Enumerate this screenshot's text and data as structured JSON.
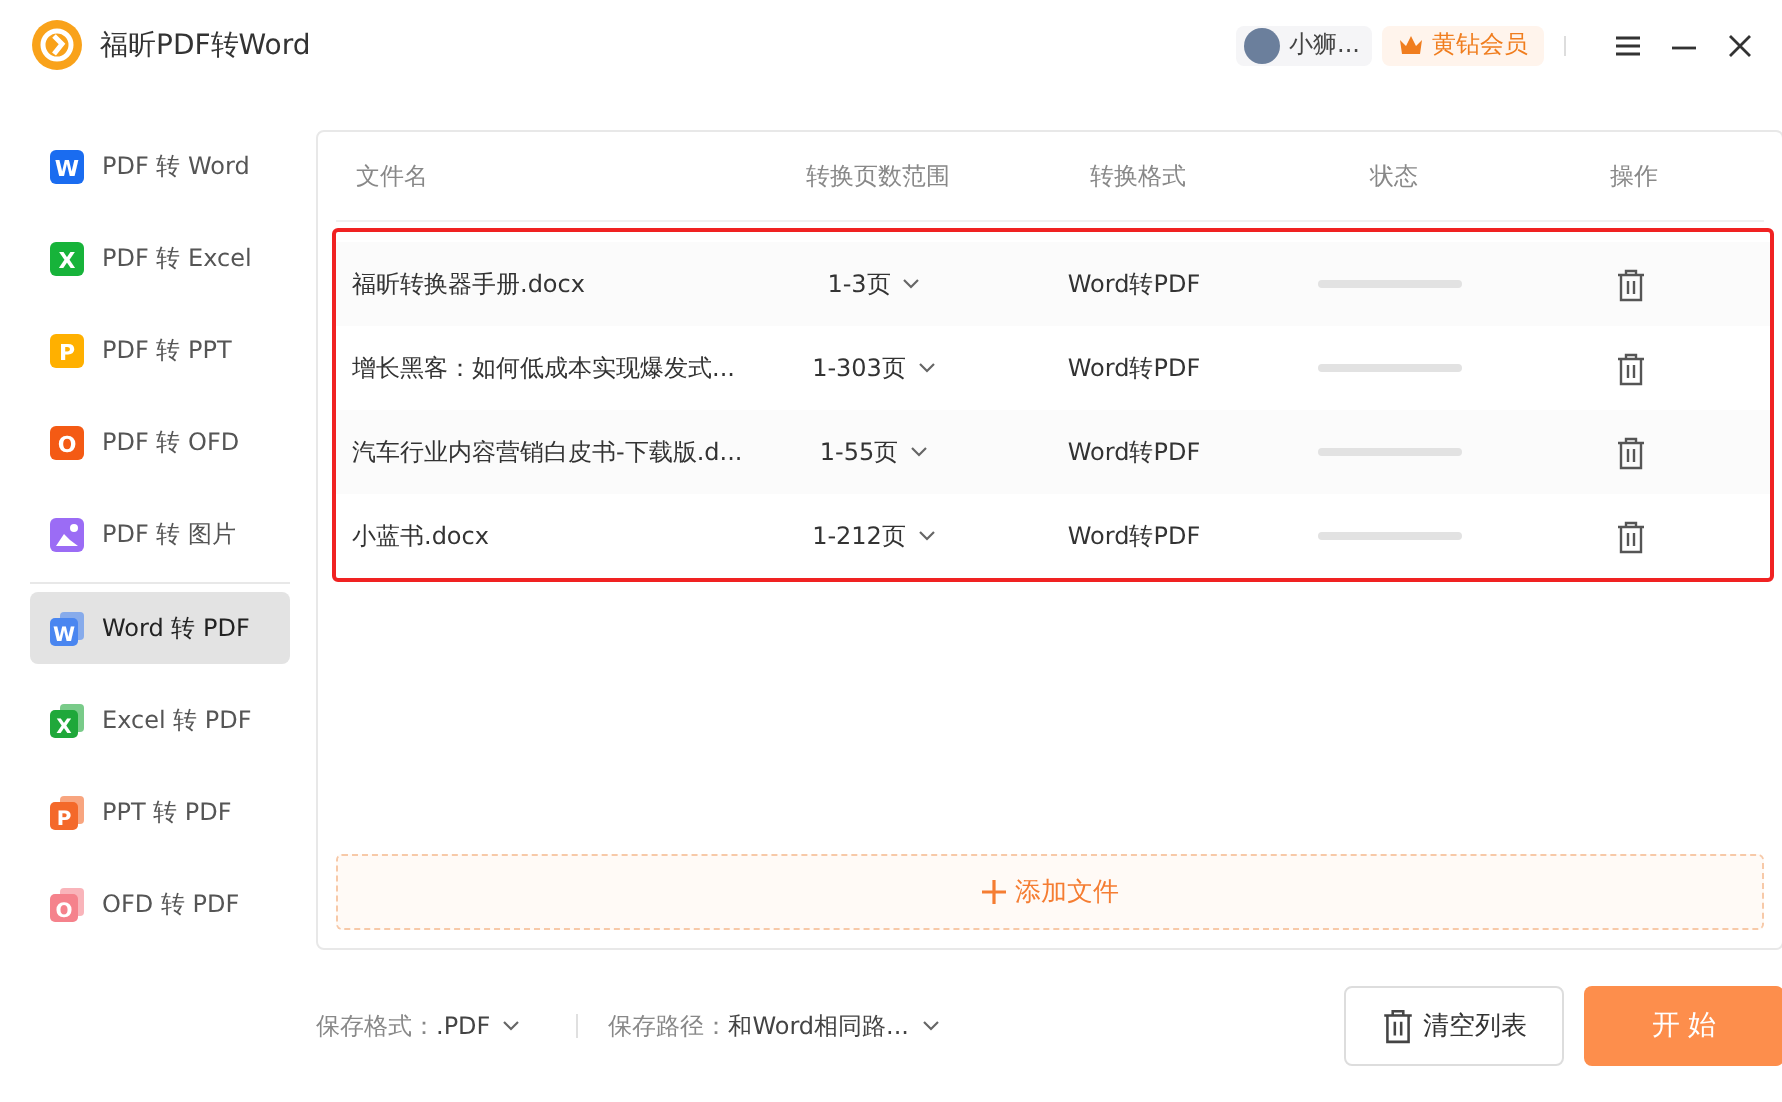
{
  "window": {
    "title": "福昕PDF转Word",
    "user": "小狮...",
    "vip": "黄钻会员"
  },
  "sidebar": {
    "items": [
      {
        "label": "PDF 转 Word",
        "kind": "letter",
        "letter": "W",
        "color": "#1a6cf0",
        "selected": false
      },
      {
        "label": "PDF 转 Excel",
        "kind": "letter",
        "letter": "X",
        "color": "#17b33a",
        "selected": false
      },
      {
        "label": "PDF 转 PPT",
        "kind": "letter",
        "letter": "P",
        "color": "#ffb000",
        "selected": false
      },
      {
        "label": "PDF 转 OFD",
        "kind": "letter",
        "letter": "O",
        "color": "#f45a14",
        "selected": false
      },
      {
        "label": "PDF 转 图片",
        "kind": "image",
        "color": "#9b6cf5",
        "selected": false
      },
      {
        "label": "Word 转 PDF",
        "kind": "stacked",
        "letter": "W",
        "color": "#4a86f0",
        "selected": true
      },
      {
        "label": "Excel 转 PDF",
        "kind": "stacked",
        "letter": "X",
        "color": "#1fa83a",
        "selected": false
      },
      {
        "label": "PPT 转 PDF",
        "kind": "stacked",
        "letter": "P",
        "color": "#f4692a",
        "selected": false
      },
      {
        "label": "OFD 转 PDF",
        "kind": "stacked",
        "letter": "O",
        "color": "#f5828c",
        "selected": false
      }
    ]
  },
  "table": {
    "columns": [
      "文件名",
      "转换页数范围",
      "转换格式",
      "状态",
      "操作"
    ],
    "rows": [
      {
        "name": "福昕转换器手册.docx",
        "range": "1-3页",
        "format": "Word转PDF"
      },
      {
        "name": "增长黑客：如何低成本实现爆发式...",
        "range": "1-303页",
        "format": "Word转PDF"
      },
      {
        "name": "汽车行业内容营销白皮书-下载版.d...",
        "range": "1-55页",
        "format": "Word转PDF"
      },
      {
        "name": "小蓝书.docx",
        "range": "1-212页",
        "format": "Word转PDF"
      }
    ]
  },
  "add_file": "添加文件",
  "footer": {
    "format_label": "保存格式：",
    "format_value": ".PDF",
    "path_label": "保存路径：",
    "path_value": "和Word相同路...",
    "clear_button": "清空列表",
    "start_button": "开 始"
  }
}
